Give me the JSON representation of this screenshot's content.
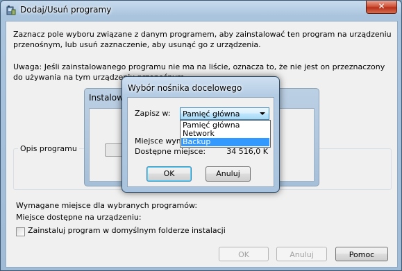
{
  "window": {
    "title": "Dodaj/Usuń programy",
    "close_label": "✕",
    "description": "Zaznacz pole wyboru związane z danym programem, aby zainstalować ten program na urządzeniu przenośnym, lub usuń zaznaczenie, aby usunąć go z urządzenia.",
    "warning": "Uwaga: Jeśli zainstalowanego programu nie ma na liście, oznacza to, że nie jest on przeznaczony do używania na tym urządzeniu przenośnym.",
    "installed_panel_label": "Instalowa",
    "program_desc_label": "Opis programu",
    "required_space_label": "Wymagane miejsce dla wybranych programów:",
    "available_space_label": "Miejsce dostępne na urządzeniu:",
    "checkbox_label": "Zainstaluj program w domyślnym folderze instalacji",
    "buttons": {
      "ok": "OK",
      "cancel": "Anuluj",
      "help": "Pomoc"
    }
  },
  "dialog": {
    "title": "Wybór nośnika docelowego",
    "save_in_label": "Zapisz w:",
    "combo_value": "Pamięć główna",
    "options": [
      "Pamięć główna",
      "Network",
      "Backup"
    ],
    "selected_option": "Backup",
    "required_label": "Miejsce wym",
    "available_label": "Dostępne miejsce:",
    "available_value": "34 516,0 K",
    "ok": "OK",
    "cancel": "Anuluj"
  },
  "icons": {
    "app": "setup-icon",
    "close": "close-icon",
    "dropdown_arrow": "chevron-down-icon"
  }
}
